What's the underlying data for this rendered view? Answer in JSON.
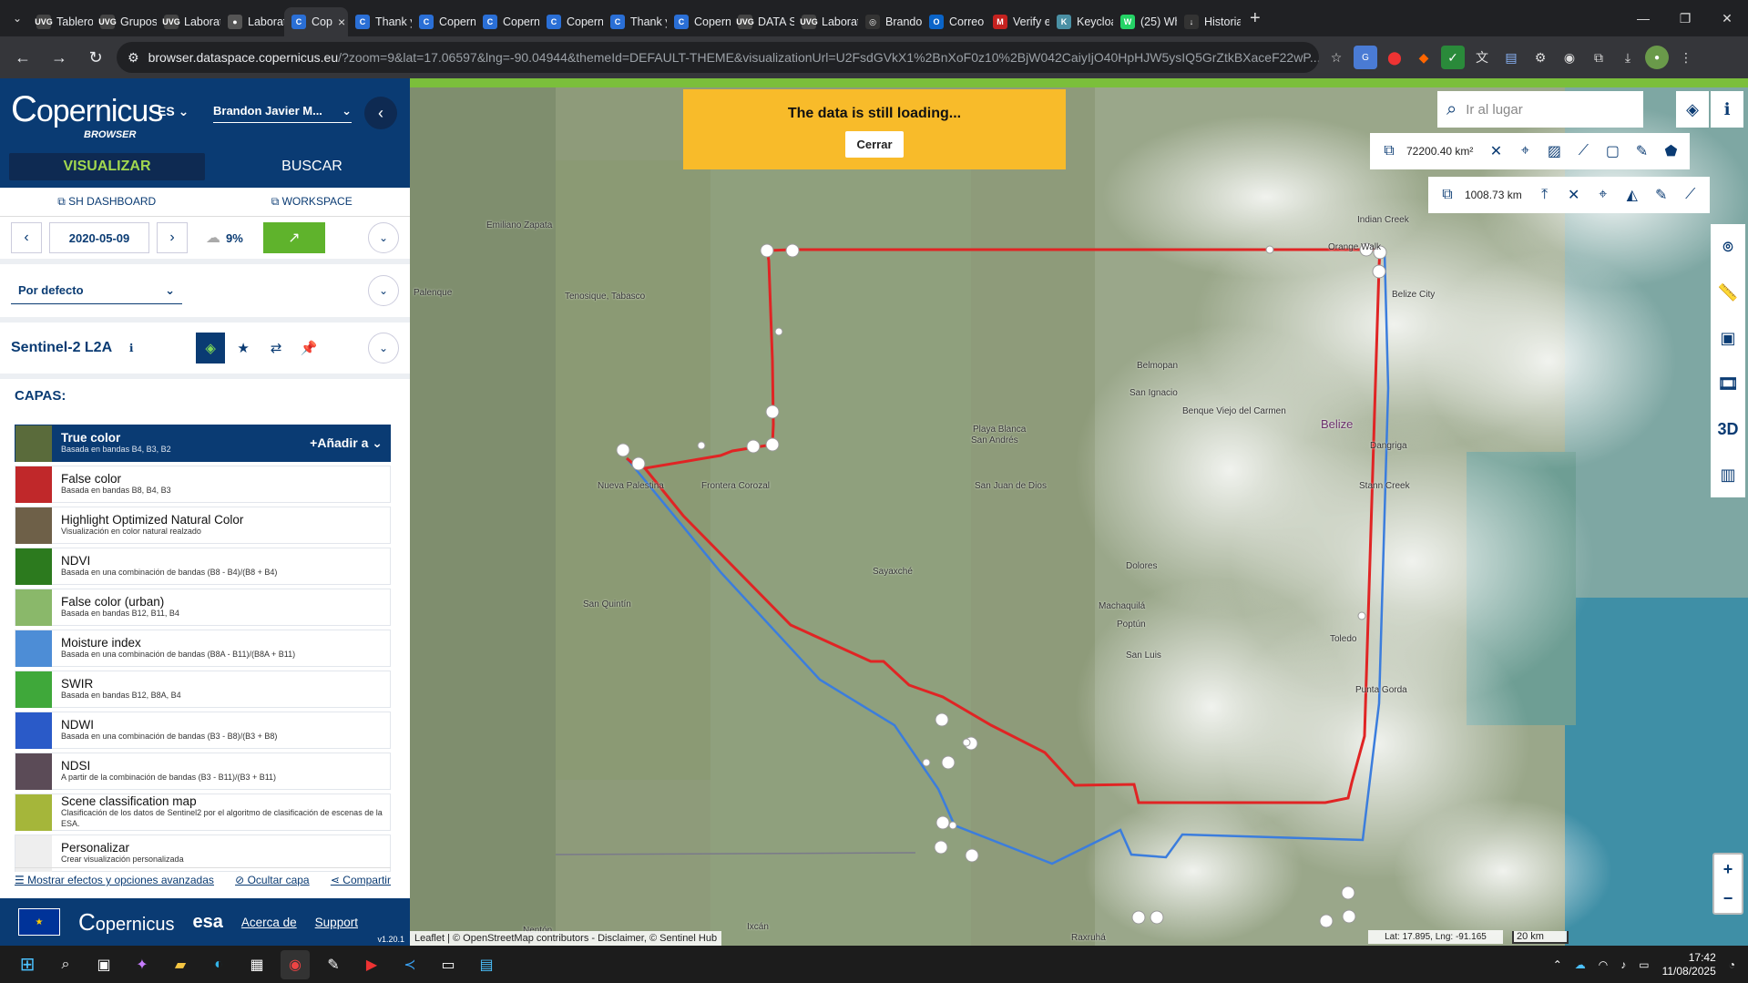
{
  "browser": {
    "tabs": [
      {
        "label": "Tablero",
        "fav": "UVG",
        "color": "#444"
      },
      {
        "label": "Grupos",
        "fav": "UVG",
        "color": "#444"
      },
      {
        "label": "Laborat",
        "fav": "UVG",
        "color": "#444"
      },
      {
        "label": "Laborat",
        "fav": "●",
        "color": "#555"
      },
      {
        "label": "Cop",
        "fav": "C",
        "color": "#2a6fd6",
        "active": true
      },
      {
        "label": "Thank y",
        "fav": "C",
        "color": "#2a6fd6"
      },
      {
        "label": "Copern",
        "fav": "C",
        "color": "#2a6fd6"
      },
      {
        "label": "Copern",
        "fav": "C",
        "color": "#2a6fd6"
      },
      {
        "label": "Copern",
        "fav": "C",
        "color": "#2a6fd6"
      },
      {
        "label": "Thank y",
        "fav": "C",
        "color": "#2a6fd6"
      },
      {
        "label": "Copern",
        "fav": "C",
        "color": "#2a6fd6"
      },
      {
        "label": "DATA S",
        "fav": "UVG",
        "color": "#444"
      },
      {
        "label": "Laborat",
        "fav": "UVG",
        "color": "#444"
      },
      {
        "label": "Brando",
        "fav": "◎",
        "color": "#333"
      },
      {
        "label": "Correo",
        "fav": "O",
        "color": "#0a64c8"
      },
      {
        "label": "Verify e",
        "fav": "M",
        "color": "#c5221f"
      },
      {
        "label": "Keycloa",
        "fav": "K",
        "color": "#4a90a4"
      },
      {
        "label": "(25) Wh",
        "fav": "W",
        "color": "#25d366"
      },
      {
        "label": "Historia",
        "fav": "↓",
        "color": "#333"
      }
    ],
    "url_host": "browser.dataspace.copernicus.eu",
    "url_rest": "/?zoom=9&lat=17.06597&lng=-90.04944&themeId=DEFAULT-THEME&visualizationUrl=U2FsdGVkX1%2BnXoF0z10%2BjW042CaiyIjO40HpHJW5ysIQ5GrZtkBXaceF22wP..."
  },
  "sidebar": {
    "logo": "opernicus",
    "logo_sub": "BROWSER",
    "lang": "ES",
    "user": "Brandon Javier M...",
    "tab_visualize": "VISUALIZAR",
    "tab_search": "BUSCAR",
    "link_sh": "SH DASHBOARD",
    "link_ws": "WORKSPACE",
    "date": "2020-05-09",
    "cloud": "9%",
    "preset": "Por defecto",
    "dataset": "Sentinel-2 L2A",
    "capas": "CAPAS:",
    "add_to": "Añadir a",
    "layers": [
      {
        "name": "True color",
        "desc": "Basada en bandas B4, B3, B2",
        "color": "#5a6b3b",
        "selected": true
      },
      {
        "name": "False color",
        "desc": "Basada en bandas B8, B4, B3",
        "color": "#c0282a"
      },
      {
        "name": "Highlight Optimized Natural Color",
        "desc": "Visualización en color natural realzado",
        "color": "#6e6048"
      },
      {
        "name": "NDVI",
        "desc": "Basada en una combinación de bandas (B8 - B4)/(B8 + B4)",
        "color": "#2c7a1e"
      },
      {
        "name": "False color (urban)",
        "desc": "Basada en bandas B12, B11, B4",
        "color": "#8ab86a"
      },
      {
        "name": "Moisture index",
        "desc": "Basada en una combinación de bandas (B8A - B11)/(B8A + B11)",
        "color": "#4d8dd6"
      },
      {
        "name": "SWIR",
        "desc": "Basada en bandas B12, B8A, B4",
        "color": "#3fa83a"
      },
      {
        "name": "NDWI",
        "desc": "Basada en una combinación de bandas (B3 - B8)/(B3 + B8)",
        "color": "#2a5ac8"
      },
      {
        "name": "NDSI",
        "desc": "A partir de la combinación de bandas (B3 - B11)/(B3 + B11)",
        "color": "#5b4b57"
      },
      {
        "name": "Scene classification map",
        "desc": "Clasificación de los datos de Sentinel2 por el algoritmo de clasificación de escenas de la ESA.",
        "color": "#a5b63a"
      },
      {
        "name": "Personalizar",
        "desc": "Crear visualización personalizada",
        "color": "#eeeeee"
      }
    ],
    "opt_effects": "Mostrar efectos y opciones avanzadas",
    "opt_hide": "Ocultar capa",
    "opt_share": "Compartir",
    "foot_about": "Acerca de",
    "foot_support": "Support",
    "foot_esa": "esa",
    "foot_logo": "opernicus",
    "version": "v1.20.1"
  },
  "map": {
    "banner_text": "The data is still loading...",
    "banner_btn": "Cerrar",
    "search_placeholder": "Ir al lugar",
    "area_measure": "72200.40 km²",
    "dist_measure": "1008.73 km",
    "attribution": "Leaflet | © OpenStreetMap contributors - Disclaimer, © Sentinel Hub",
    "coords": "Lat: 17.895, Lng: -91.165",
    "scale": "20 km",
    "btn_3d": "3D",
    "places": [
      {
        "name": "Emiliano Zapata",
        "cls": ""
      },
      {
        "name": "Palenque",
        "cls": ""
      },
      {
        "name": "Tenosique, Tabasco",
        "cls": ""
      },
      {
        "name": "Nueva Palestina",
        "cls": ""
      },
      {
        "name": "Frontera Corozal",
        "cls": ""
      },
      {
        "name": "San Quintín",
        "cls": ""
      },
      {
        "name": "Sayaxché",
        "cls": ""
      },
      {
        "name": "Playa Blanca",
        "cls": ""
      },
      {
        "name": "San Andrés",
        "cls": ""
      },
      {
        "name": "San Ignacio",
        "cls": ""
      },
      {
        "name": "Belmopan",
        "cls": ""
      },
      {
        "name": "Belize",
        "cls": "big"
      },
      {
        "name": "Dangriga",
        "cls": ""
      },
      {
        "name": "Stann Creek",
        "cls": ""
      },
      {
        "name": "Indian Creek",
        "cls": ""
      },
      {
        "name": "Orange Walk",
        "cls": ""
      },
      {
        "name": "Poptún",
        "cls": ""
      },
      {
        "name": "Dolores",
        "cls": ""
      },
      {
        "name": "San Luis",
        "cls": ""
      },
      {
        "name": "Machaquilá",
        "cls": ""
      },
      {
        "name": "Punta Gorda",
        "cls": ""
      },
      {
        "name": "Toledo",
        "cls": ""
      },
      {
        "name": "Nentón",
        "cls": ""
      },
      {
        "name": "Ixcán",
        "cls": ""
      },
      {
        "name": "Raxruhá",
        "cls": ""
      },
      {
        "name": "San Juan de Dios",
        "cls": ""
      },
      {
        "name": "Benque Viejo del Carmen",
        "cls": ""
      },
      {
        "name": "Belize City",
        "cls": ""
      }
    ]
  },
  "taskbar": {
    "time": "17:42",
    "date": "11/08/2025"
  }
}
